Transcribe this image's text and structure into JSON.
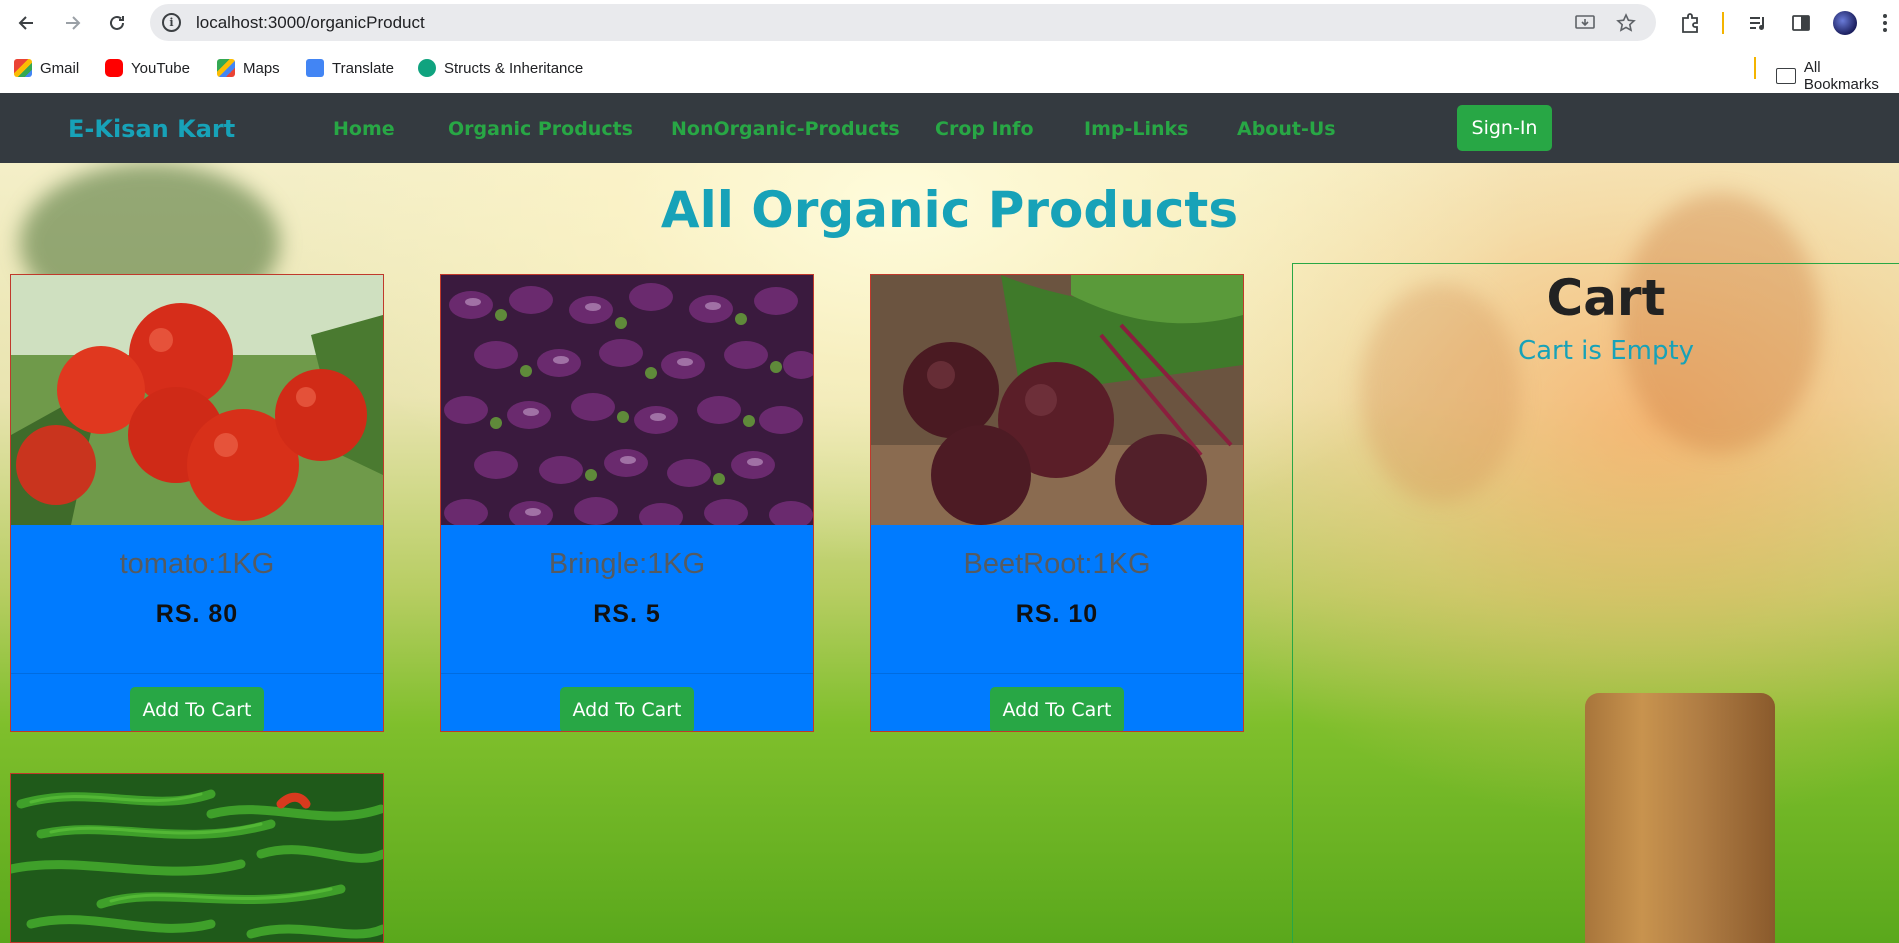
{
  "browser": {
    "url": "localhost:3000/organicProduct",
    "bookmarks": [
      {
        "label": "Gmail",
        "color": "#ea4335"
      },
      {
        "label": "YouTube",
        "color": "#ff0000"
      },
      {
        "label": "Maps",
        "color": "#34a853"
      },
      {
        "label": "Translate",
        "color": "#4285f4"
      },
      {
        "label": "Structs & Inheritance",
        "color": "#10a37f"
      }
    ],
    "all_bookmarks_label": "All Bookmarks"
  },
  "navbar": {
    "brand": "E-Kisan Kart",
    "links": [
      "Home",
      "Organic Products",
      "NonOrganic-Products",
      "Crop Info",
      "Imp-Links",
      "About-Us"
    ],
    "signin_label": "Sign-In"
  },
  "page": {
    "title": "All Organic Products"
  },
  "products": [
    {
      "name": "tomato:1KG",
      "price": "RS. 80",
      "button": "Add To Cart",
      "image": "tomatoes"
    },
    {
      "name": "Bringle:1KG",
      "price": "RS. 5",
      "button": "Add To Cart",
      "image": "brinjals"
    },
    {
      "name": "BeetRoot:1KG",
      "price": "RS. 10",
      "button": "Add To Cart",
      "image": "beetroots"
    }
  ],
  "partial_product": {
    "image": "green-chillies"
  },
  "cart": {
    "title": "Cart",
    "empty_message": "Cart is Empty"
  },
  "colors": {
    "navbar_bg": "#343a40",
    "brand": "#17a2b8",
    "nav_link": "#28a745",
    "button": "#28a745",
    "card_bg": "#007bff"
  }
}
